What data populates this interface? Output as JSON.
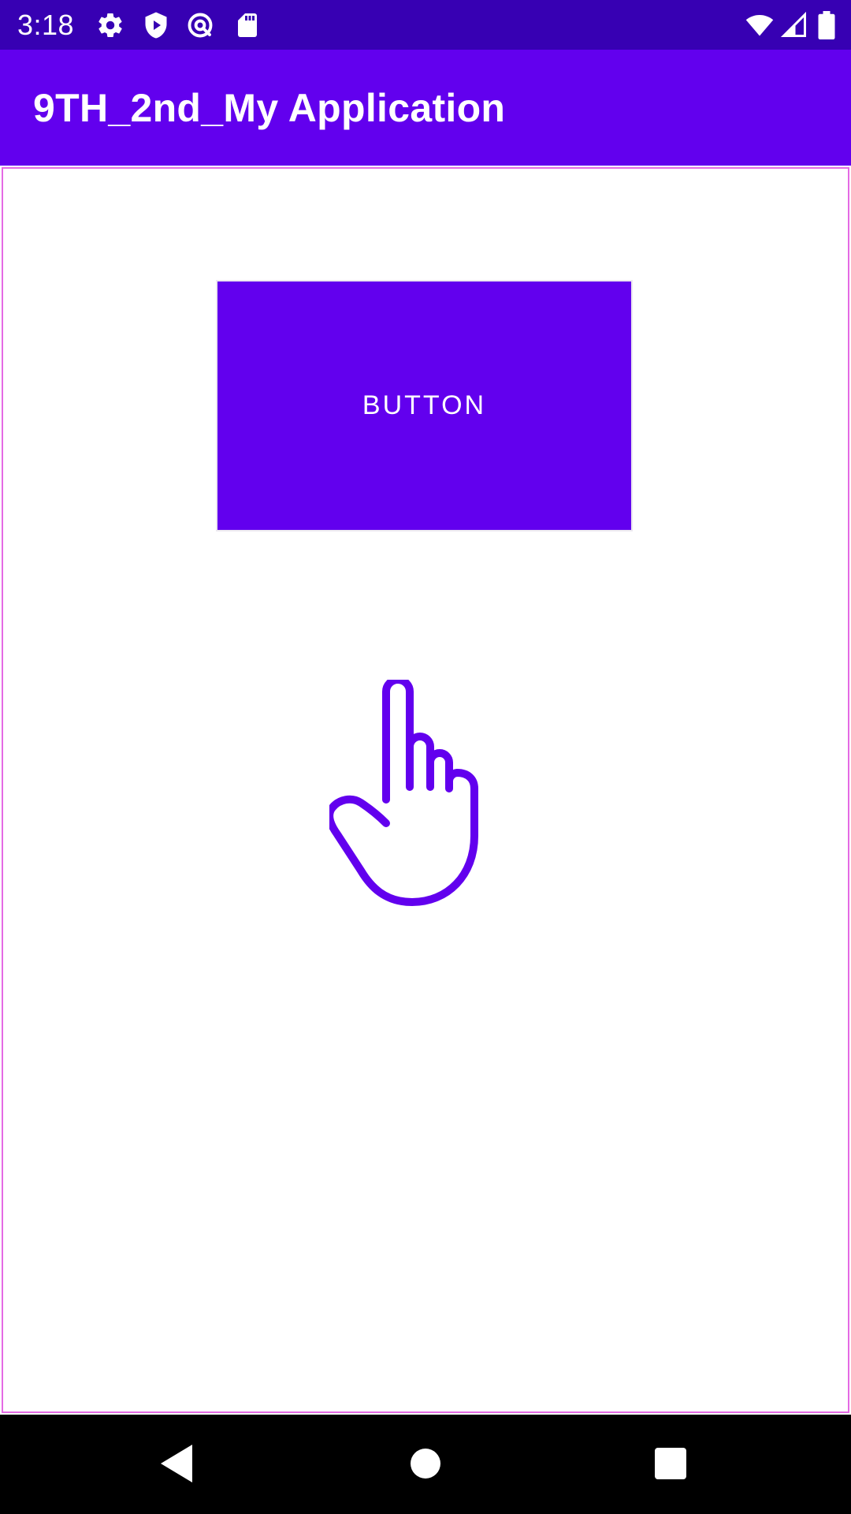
{
  "status_bar": {
    "time": "3:18",
    "icons_left": [
      "gear-icon",
      "play-protect-icon",
      "at-sign-icon",
      "sd-card-icon"
    ],
    "icons_right": [
      "wifi-icon",
      "cellular-signal-icon",
      "battery-icon"
    ]
  },
  "app_bar": {
    "title": "9TH_2nd_My Application"
  },
  "main": {
    "button_label": "BUTTON",
    "image_icon": "pointing-hand-icon"
  },
  "nav_bar": {
    "buttons": [
      "back-icon",
      "home-icon",
      "recents-icon"
    ]
  },
  "colors": {
    "status_bar": "#3700B3",
    "primary": "#6200EE",
    "frame_border": "#E46AE4",
    "background": "#FFFFFF",
    "nav_bar": "#000000"
  }
}
